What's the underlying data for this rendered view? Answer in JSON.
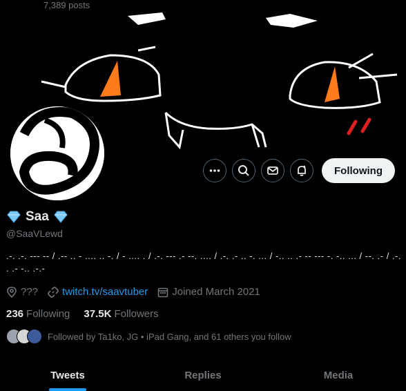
{
  "header": {
    "post_count": "7,389 posts"
  },
  "actions": {
    "follow_label": "Following"
  },
  "profile": {
    "display_name": "Saa",
    "handle": "@SaaVLewd",
    "bio": ".-. .-. --- -- / .-- .. - .... .. -. / - .... . / .-. --- .- --. .... / .-. .- .. -. ... / -.. .. .- -- --- -. -.. ... / --. .- / .-. . .- -.. .-.-",
    "location": "???",
    "website": "twitch.tv/saavtuber",
    "joined": "Joined March 2021"
  },
  "stats": {
    "following_count": "236",
    "following_label": "Following",
    "followers_count": "37.5K",
    "followers_label": "Followers"
  },
  "followed_by": "Followed by Ta1ko, JG • iPad Gang, and 61 others you follow",
  "tabs": [
    {
      "label": "Tweets",
      "active": true
    },
    {
      "label": "Replies",
      "active": false
    },
    {
      "label": "Media",
      "active": false
    }
  ],
  "colors": {
    "accent": "#1d9bf0",
    "diamond": "#7ec8f5"
  },
  "icons": [
    "more-icon",
    "search-icon",
    "message-icon",
    "notification-bell-icon",
    "location-icon",
    "link-icon",
    "calendar-icon",
    "diamond-icon"
  ]
}
